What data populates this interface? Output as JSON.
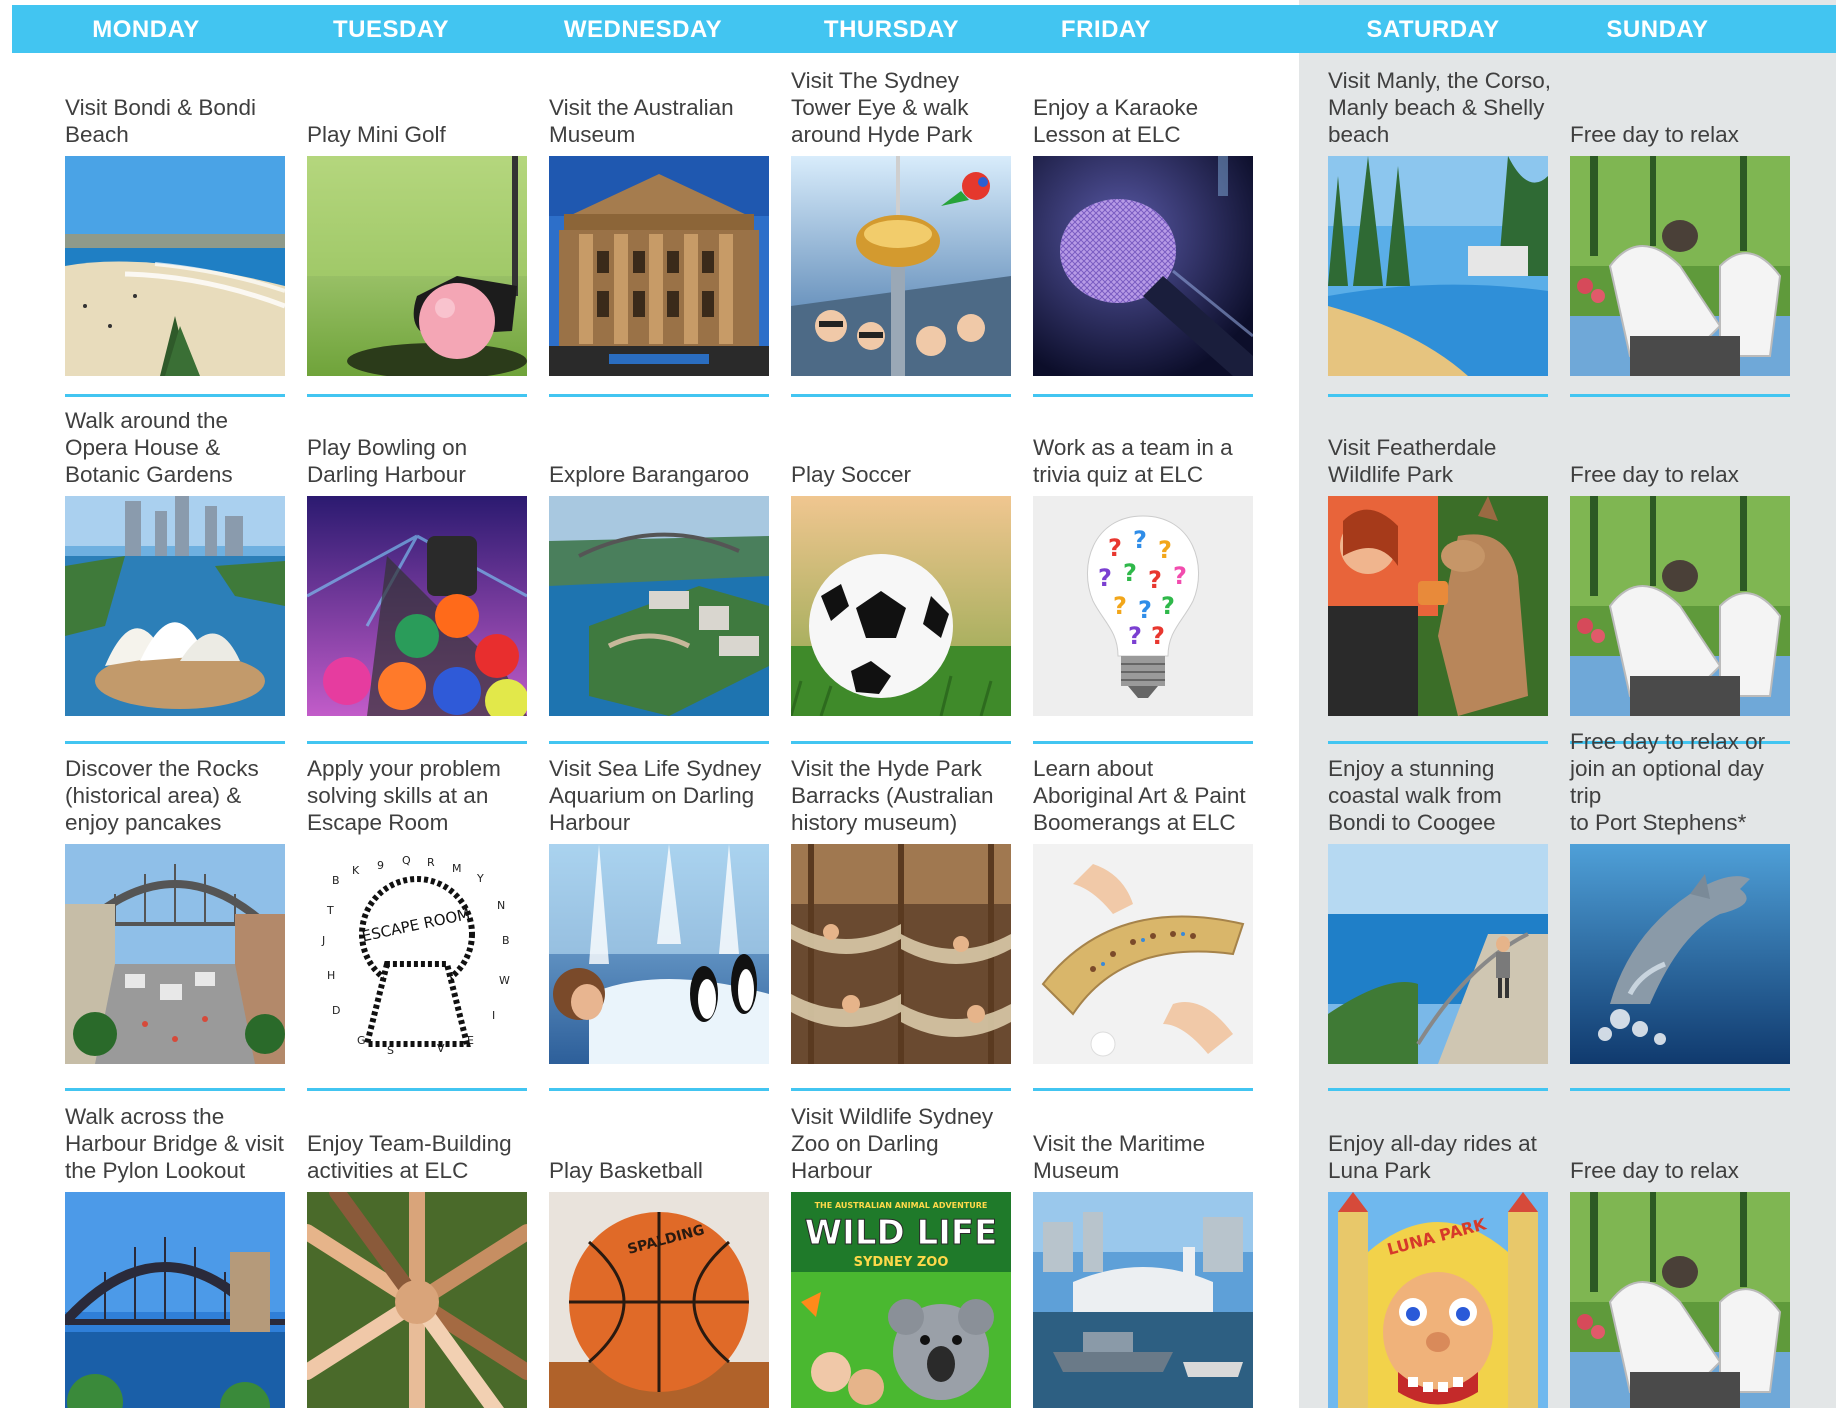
{
  "days": [
    "MONDAY",
    "TUESDAY",
    "WEDNESDAY",
    "THURSDAY",
    "FRIDAY",
    "SATURDAY",
    "SUNDAY"
  ],
  "colors": {
    "accent": "#42c5f1",
    "weekend_panel": "#e3e6e7",
    "text": "#3f3f3f"
  },
  "weeks": [
    {
      "activities": [
        {
          "label": "Visit Bondi & Bondi\nBeach",
          "image": "bondi-beach-photo"
        },
        {
          "label": "Play Mini Golf",
          "image": "mini-golf-photo"
        },
        {
          "label": "Visit the Australian\nMuseum",
          "image": "australian-museum-photo"
        },
        {
          "label": "Visit The Sydney\nTower Eye & walk\naround Hyde Park",
          "image": "sydney-tower-eye-photo"
        },
        {
          "label": "Enjoy a Karaoke\nLesson at ELC",
          "image": "microphone-photo"
        },
        {
          "label": "Visit Manly, the Corso,\nManly beach & Shelly\nbeach",
          "image": "manly-beach-photo"
        },
        {
          "label": "Free day to relax",
          "image": "relaxing-feet-dog-photo"
        }
      ]
    },
    {
      "activities": [
        {
          "label": "Walk around the\nOpera House &\nBotanic Gardens",
          "image": "opera-house-photo"
        },
        {
          "label": "Play Bowling on\nDarling Harbour",
          "image": "bowling-balls-photo"
        },
        {
          "label": "Explore Barangaroo",
          "image": "barangaroo-aerial-photo"
        },
        {
          "label": "Play Soccer",
          "image": "soccer-ball-photo"
        },
        {
          "label": "Work as a team in a\ntrivia quiz at ELC",
          "image": "question-mark-lightbulb-photo"
        },
        {
          "label": "Visit Featherdale\nWildlife Park",
          "image": "kangaroo-feeding-photo"
        },
        {
          "label": "Free day to relax",
          "image": "relaxing-feet-dog-photo"
        }
      ]
    },
    {
      "activities": [
        {
          "label": "Discover the Rocks\n(historical area) &\nenjoy pancakes",
          "image": "the-rocks-photo"
        },
        {
          "label": "Apply your problem\nsolving skills at an\nEscape Room",
          "image": "escape-room-keyhole-photo",
          "image_text": "ESCAPE ROOM"
        },
        {
          "label": "Visit Sea Life Sydney\nAquarium on Darling\nHarbour",
          "image": "penguin-aquarium-photo"
        },
        {
          "label": "Visit the Hyde Park\nBarracks (Australian\nhistory museum)",
          "image": "hammocks-barracks-photo"
        },
        {
          "label": "Learn about\nAboriginal Art & Paint\nBoomerangs at ELC",
          "image": "painted-boomerang-photo"
        },
        {
          "label": "Enjoy a stunning\ncoastal walk from\nBondi to Coogee",
          "image": "coastal-walk-photo"
        },
        {
          "label": "Free day to relax or\njoin an optional day trip\nto Port Stephens*",
          "image": "jumping-dolphin-photo"
        }
      ]
    },
    {
      "activities": [
        {
          "label": "Walk across the\nHarbour Bridge & visit\nthe Pylon Lookout",
          "image": "harbour-bridge-photo"
        },
        {
          "label": "Enjoy Team-Building\nactivities at ELC",
          "image": "joined-hands-photo"
        },
        {
          "label": "Play Basketball",
          "image": "basketball-photo"
        },
        {
          "label": "Visit Wildlife Sydney\nZoo on Darling\nHarbour",
          "image": "wildlife-zoo-poster-photo",
          "image_text": "WILD LIFE",
          "image_subtext": "SYDNEY ZOO",
          "image_topline": "THE AUSTRALIAN ANIMAL ADVENTURE"
        },
        {
          "label": "Visit the Maritime\nMuseum",
          "image": "maritime-museum-photo"
        },
        {
          "label": "Enjoy all-day rides at\nLuna Park",
          "image": "luna-park-photo",
          "image_text": "LUNA PARK"
        },
        {
          "label": "Free day to relax",
          "image": "relaxing-feet-dog-photo"
        }
      ]
    }
  ]
}
